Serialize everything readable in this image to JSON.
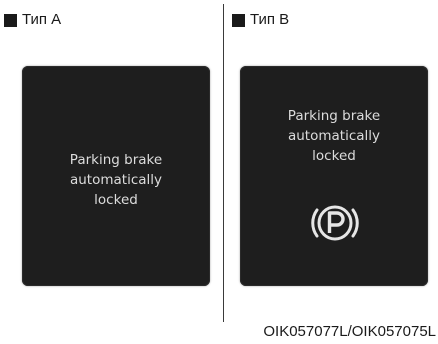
{
  "panel_a": {
    "label": "Тип A",
    "message": "Parking brake\nautomatically\nlocked"
  },
  "panel_b": {
    "label": "Тип B",
    "message": "Parking brake\nautomatically\nlocked",
    "icon": "parking-brake-icon"
  },
  "caption": "OIK057077L/OIK057075L",
  "colors": {
    "screen_background": "#1e1e1e",
    "screen_text": "#dcdcdc"
  }
}
